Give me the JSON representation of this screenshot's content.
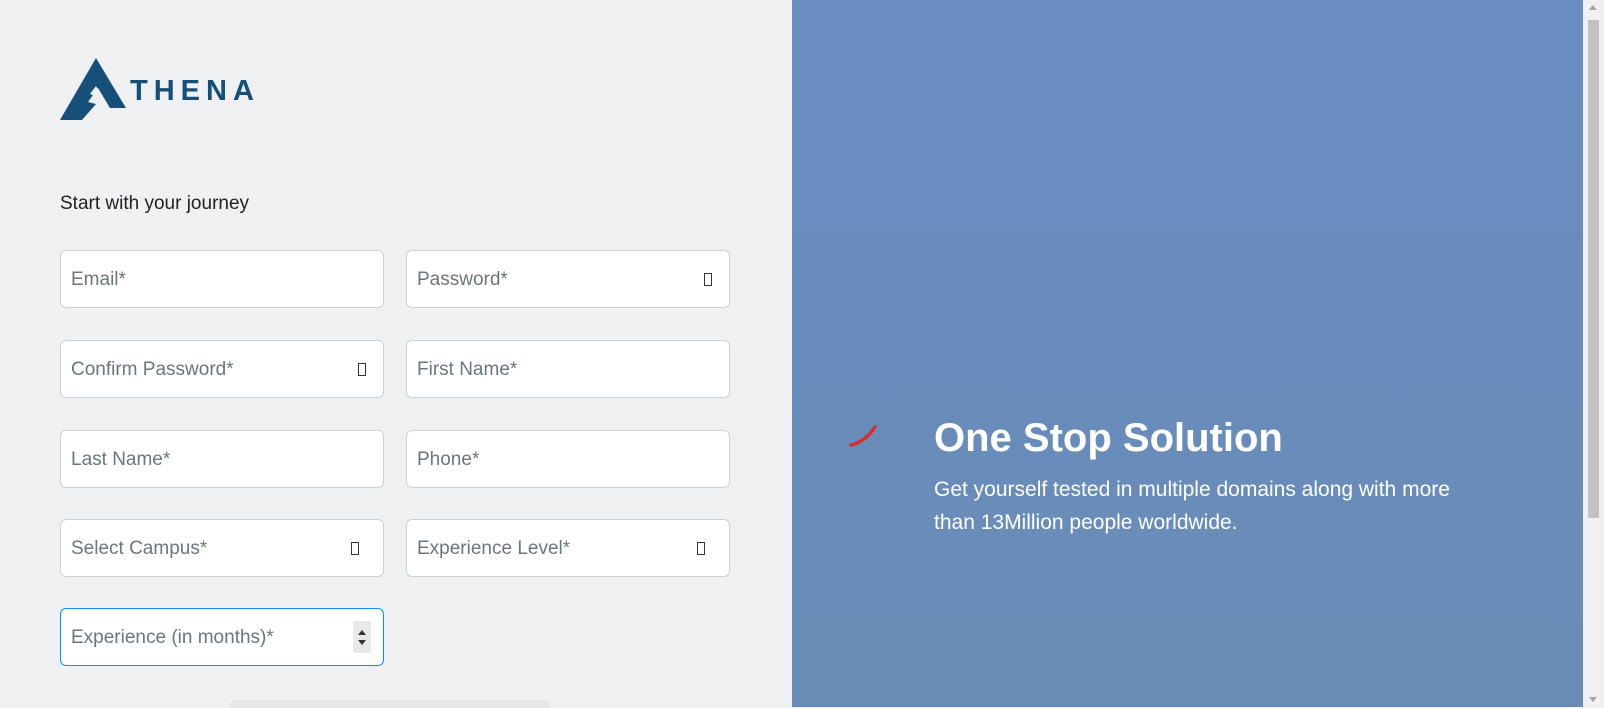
{
  "brand": {
    "logo_text": "THENA",
    "logo_icon": "athena-a-logo"
  },
  "form": {
    "subtitle": "Start with your journey",
    "fields": {
      "email": {
        "placeholder": "Email*",
        "value": ""
      },
      "password": {
        "placeholder": "Password*",
        "value": "",
        "icon": "password-toggle-icon"
      },
      "confirm_password": {
        "placeholder": "Confirm Password*",
        "value": "",
        "icon": "password-toggle-icon"
      },
      "first_name": {
        "placeholder": "First Name*",
        "value": ""
      },
      "last_name": {
        "placeholder": "Last Name*",
        "value": ""
      },
      "phone": {
        "placeholder": "Phone*",
        "value": ""
      },
      "campus": {
        "placeholder": "Select Campus*",
        "value": "",
        "icon": "dropdown-icon"
      },
      "experience_level": {
        "placeholder": "Experience Level*",
        "value": "",
        "icon": "dropdown-icon"
      },
      "experience_months": {
        "placeholder": "Experience (in months)*",
        "value": "",
        "icon": "number-spinner"
      }
    }
  },
  "hero": {
    "title": "One Stop Solution",
    "text": "Get yourself tested in multiple domains along with more than 13Million people worldwide."
  },
  "colors": {
    "left_bg": "#eff0f2",
    "right_bg": "#688dc1",
    "brand": "#174f7b",
    "focus": "#0d8ef0",
    "loader": "#d2312f"
  }
}
